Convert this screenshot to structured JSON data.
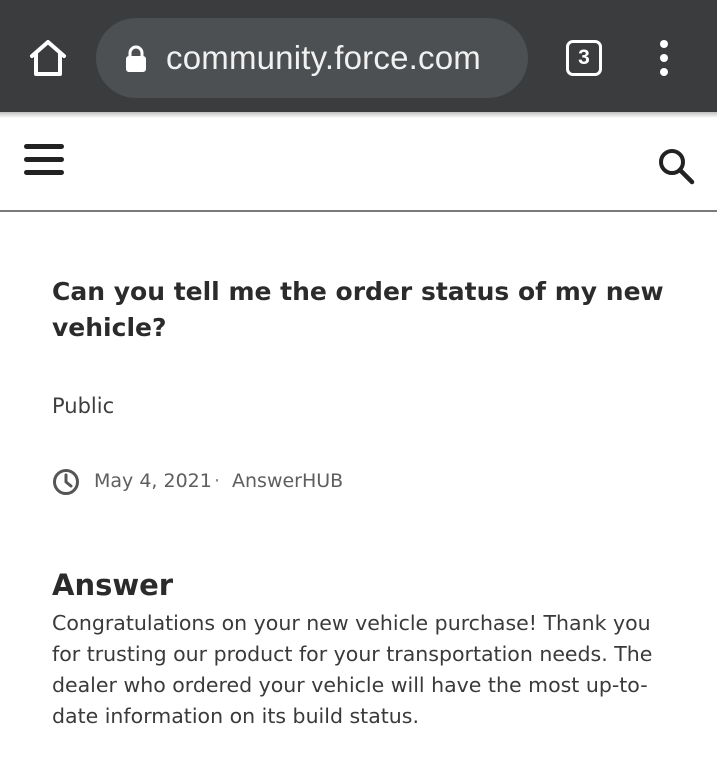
{
  "browser": {
    "url": "community.force.com",
    "tab_count": "3",
    "icons": {
      "home": "home-icon",
      "lock": "lock-icon",
      "menu": "more-vert-icon"
    },
    "colors": {
      "toolbar": "#3a3c3e",
      "url_pill": "#4d5052"
    }
  },
  "header": {
    "icons": {
      "menu": "hamburger-icon",
      "search": "search-icon"
    }
  },
  "question": {
    "title": "Can you tell me the order status of my new vehicle?",
    "visibility": "Public",
    "date": "May 4, 2021",
    "separator": "·",
    "author": "AnswerHUB"
  },
  "answer": {
    "heading": "Answer",
    "body": "Congratulations on your new vehicle purchase! Thank you for trusting our product for your transportation needs. The dealer who ordered your vehicle will have the most up-to-date information on its build status."
  }
}
